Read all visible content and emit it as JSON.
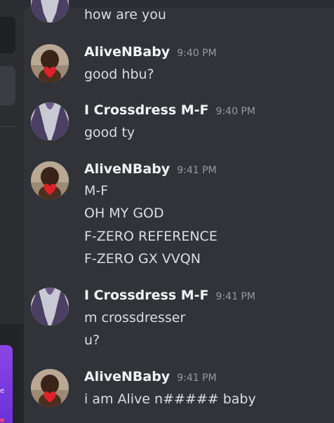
{
  "sidebar": {
    "promo_char": "e"
  },
  "messages": [
    {
      "user": "",
      "time": "",
      "lines": [
        "how are you"
      ],
      "avatar": "crossdress-avatar"
    },
    {
      "user": "AliveNBaby",
      "time": "9:40 PM",
      "lines": [
        "good hbu?"
      ],
      "avatar": "baby-avatar"
    },
    {
      "user": "I Crossdress M-F",
      "time": "9:40 PM",
      "lines": [
        "good ty"
      ],
      "avatar": "crossdress-avatar"
    },
    {
      "user": "AliveNBaby",
      "time": "9:41 PM",
      "lines": [
        "M-F",
        "OH MY GOD",
        "F-ZERO REFERENCE",
        "F-ZERO GX VVQN"
      ],
      "avatar": "baby-avatar"
    },
    {
      "user": "I Crossdress M-F",
      "time": "9:41 PM",
      "lines": [
        "m crossdresser",
        "u?"
      ],
      "avatar": "crossdress-avatar"
    },
    {
      "user": "AliveNBaby",
      "time": "9:41 PM",
      "lines": [
        "i am Alive n##### baby"
      ],
      "avatar": "baby-avatar"
    }
  ],
  "colors": {
    "background": "#323339",
    "username": "#f2f3f5",
    "timestamp": "#949ba4",
    "message_text": "#dbdee1",
    "promo_gradient": "#8b45e6"
  }
}
